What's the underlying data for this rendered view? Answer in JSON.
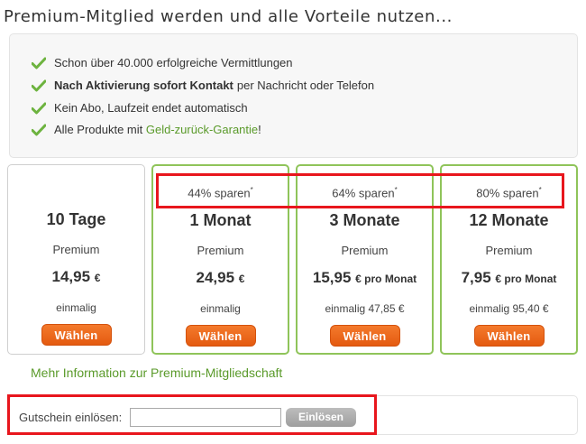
{
  "page": {
    "title": "Premium-Mitglied werden und alle Vorteile nutzen..."
  },
  "features": [
    {
      "prefix": "Schon über 40.000 erfolgreiche Vermittlungen"
    },
    {
      "bold": "Nach Aktivierung sofort Kontakt",
      "rest": "per Nachricht oder Telefon"
    },
    {
      "prefix": "Kein Abo, Laufzeit endet automatisch"
    },
    {
      "prefix": "Alle Produkte mit ",
      "link": "Geld-zurück-Garantie",
      "suffix": "!"
    }
  ],
  "plans": [
    {
      "save": "",
      "save_mark": "",
      "duration": "10 Tage",
      "kind": "Premium",
      "price": "14,95",
      "price_unit": "€",
      "note": "einmalig",
      "button": "Wählen"
    },
    {
      "save": "44% sparen",
      "save_mark": "*",
      "duration": "1 Monat",
      "kind": "Premium",
      "price": "24,95",
      "price_unit": "€",
      "note": "einmalig",
      "button": "Wählen"
    },
    {
      "save": "64% sparen",
      "save_mark": "*",
      "duration": "3 Monate",
      "kind": "Premium",
      "price": "15,95",
      "price_unit": "€ pro Monat",
      "note": "einmalig 47,85 €",
      "button": "Wählen"
    },
    {
      "save": "80% sparen",
      "save_mark": "*",
      "duration": "12 Monate",
      "kind": "Premium",
      "price": "7,95",
      "price_unit": "€ pro Monat",
      "note": "einmalig 95,40 €",
      "button": "Wählen"
    }
  ],
  "more_link": "Mehr Information zur Premium-Mitgliedschaft",
  "voucher": {
    "label": "Gutschein einlösen:",
    "value": "",
    "button": "Einlösen"
  },
  "colors": {
    "accent_green": "#8fc45a",
    "button_orange": "#e8621a",
    "highlight_red": "#e8161d"
  }
}
